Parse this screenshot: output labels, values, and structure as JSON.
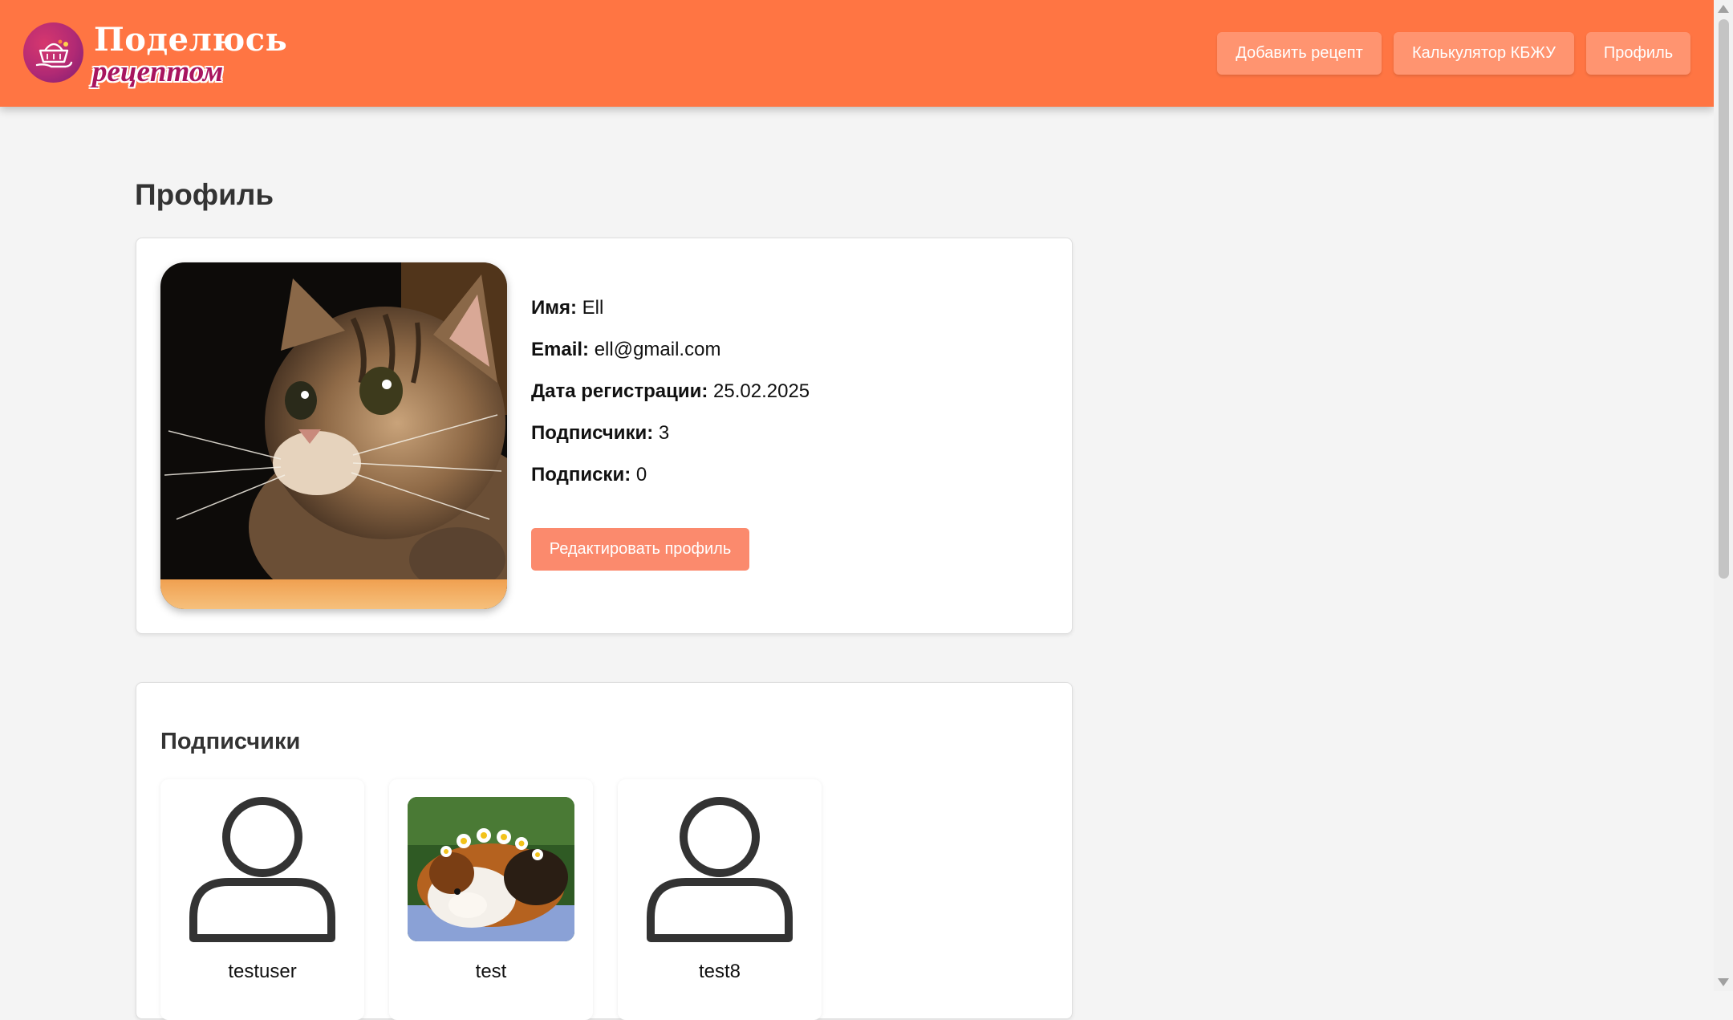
{
  "header": {
    "logo_title": "Поделюсь",
    "logo_subtitle": "рецептом",
    "nav": {
      "add_recipe": "Добавить рецепт",
      "calculator": "Калькулятор КБЖУ",
      "profile": "Профиль"
    },
    "colors": {
      "header_bg": "#ff7543",
      "button_bg": "#ff9470"
    }
  },
  "page": {
    "title": "Профиль"
  },
  "profile": {
    "avatar_icon": "cat-photo",
    "name_label": "Имя:",
    "name_value": "Ell",
    "email_label": "Email:",
    "email_value": "ell@gmail.com",
    "reg_label": "Дата регистрации:",
    "reg_value": "25.02.2025",
    "followers_label": "Подписчики:",
    "followers_value": "3",
    "following_label": "Подписки:",
    "following_value": "0",
    "edit_button": "Редактировать профиль"
  },
  "followers_section": {
    "title": "Подписчики",
    "items": [
      {
        "name": "testuser",
        "avatar": "user-icon"
      },
      {
        "name": "test",
        "avatar": "guinea-pig-photo"
      },
      {
        "name": "test8",
        "avatar": "user-icon"
      }
    ]
  }
}
